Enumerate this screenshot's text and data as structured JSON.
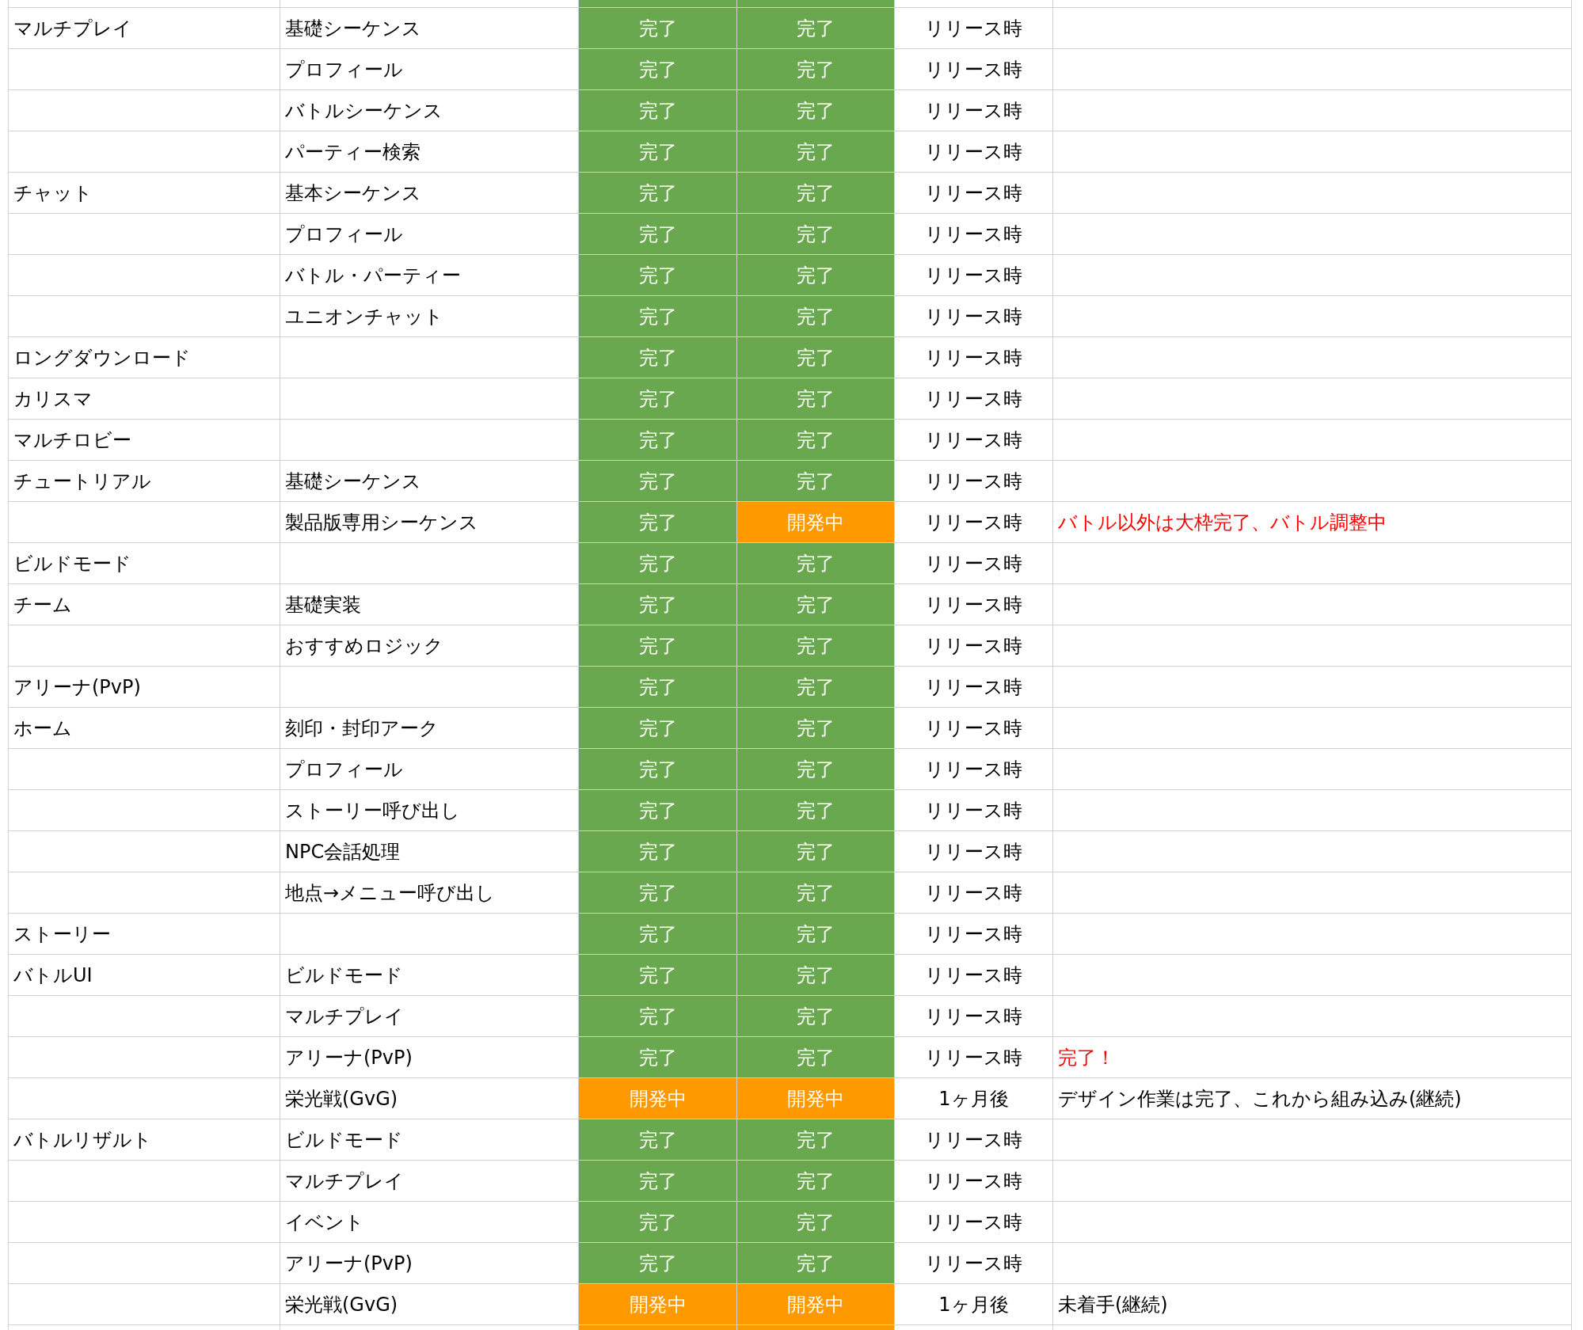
{
  "top_cut_row": {
    "status_cells": [
      {
        "color": "#6aa84f"
      },
      {
        "color": "#6aa84f"
      }
    ]
  },
  "rows": [
    {
      "category": "マルチプレイ",
      "item": "基礎シーケンス",
      "design": {
        "label": "完了",
        "color": "#6aa84f"
      },
      "impl": {
        "label": "完了",
        "color": "#6aa84f"
      },
      "timing": "リリース時"
    },
    {
      "item": "プロフィール",
      "design": {
        "label": "完了",
        "color": "#6aa84f"
      },
      "impl": {
        "label": "完了",
        "color": "#6aa84f"
      },
      "timing": "リリース時"
    },
    {
      "item": "バトルシーケンス",
      "design": {
        "label": "完了",
        "color": "#6aa84f"
      },
      "impl": {
        "label": "完了",
        "color": "#6aa84f"
      },
      "timing": "リリース時"
    },
    {
      "item": "パーティー検索",
      "design": {
        "label": "完了",
        "color": "#6aa84f"
      },
      "impl": {
        "label": "完了",
        "color": "#6aa84f"
      },
      "timing": "リリース時"
    },
    {
      "category": "チャット",
      "item": "基本シーケンス",
      "design": {
        "label": "完了",
        "color": "#6aa84f"
      },
      "impl": {
        "label": "完了",
        "color": "#6aa84f"
      },
      "timing": "リリース時"
    },
    {
      "item": "プロフィール",
      "design": {
        "label": "完了",
        "color": "#6aa84f"
      },
      "impl": {
        "label": "完了",
        "color": "#6aa84f"
      },
      "timing": "リリース時"
    },
    {
      "item": "バトル・パーティー",
      "design": {
        "label": "完了",
        "color": "#6aa84f"
      },
      "impl": {
        "label": "完了",
        "color": "#6aa84f"
      },
      "timing": "リリース時"
    },
    {
      "item": "ユニオンチャット",
      "design": {
        "label": "完了",
        "color": "#6aa84f"
      },
      "impl": {
        "label": "完了",
        "color": "#6aa84f"
      },
      "timing": "リリース時"
    },
    {
      "category": "ロングダウンロード",
      "design": {
        "label": "完了",
        "color": "#6aa84f"
      },
      "impl": {
        "label": "完了",
        "color": "#6aa84f"
      },
      "timing": "リリース時"
    },
    {
      "category": "カリスマ",
      "design": {
        "label": "完了",
        "color": "#6aa84f"
      },
      "impl": {
        "label": "完了",
        "color": "#6aa84f"
      },
      "timing": "リリース時"
    },
    {
      "category": "マルチロビー",
      "design": {
        "label": "完了",
        "color": "#6aa84f"
      },
      "impl": {
        "label": "完了",
        "color": "#6aa84f"
      },
      "timing": "リリース時"
    },
    {
      "category": "チュートリアル",
      "item": "基礎シーケンス",
      "design": {
        "label": "完了",
        "color": "#6aa84f"
      },
      "impl": {
        "label": "完了",
        "color": "#6aa84f"
      },
      "timing": "リリース時"
    },
    {
      "item": "製品版専用シーケンス",
      "design": {
        "label": "完了",
        "color": "#6aa84f"
      },
      "impl": {
        "label": "開発中",
        "color": "#ff9900"
      },
      "timing": "リリース時",
      "note": {
        "text": "バトル以外は大枠完了、バトル調整中",
        "color": "#ff0000"
      }
    },
    {
      "category": "ビルドモード",
      "design": {
        "label": "完了",
        "color": "#6aa84f"
      },
      "impl": {
        "label": "完了",
        "color": "#6aa84f"
      },
      "timing": "リリース時"
    },
    {
      "category": "チーム",
      "item": "基礎実装",
      "design": {
        "label": "完了",
        "color": "#6aa84f"
      },
      "impl": {
        "label": "完了",
        "color": "#6aa84f"
      },
      "timing": "リリース時"
    },
    {
      "item": "おすすめロジック",
      "design": {
        "label": "完了",
        "color": "#6aa84f"
      },
      "impl": {
        "label": "完了",
        "color": "#6aa84f"
      },
      "timing": "リリース時"
    },
    {
      "category": "アリーナ(PvP)",
      "design": {
        "label": "完了",
        "color": "#6aa84f"
      },
      "impl": {
        "label": "完了",
        "color": "#6aa84f"
      },
      "timing": "リリース時"
    },
    {
      "category": "ホーム",
      "item": "刻印・封印アーク",
      "design": {
        "label": "完了",
        "color": "#6aa84f"
      },
      "impl": {
        "label": "完了",
        "color": "#6aa84f"
      },
      "timing": "リリース時"
    },
    {
      "item": "プロフィール",
      "design": {
        "label": "完了",
        "color": "#6aa84f"
      },
      "impl": {
        "label": "完了",
        "color": "#6aa84f"
      },
      "timing": "リリース時"
    },
    {
      "item": "ストーリー呼び出し",
      "design": {
        "label": "完了",
        "color": "#6aa84f"
      },
      "impl": {
        "label": "完了",
        "color": "#6aa84f"
      },
      "timing": "リリース時"
    },
    {
      "item": "NPC会話処理",
      "design": {
        "label": "完了",
        "color": "#6aa84f"
      },
      "impl": {
        "label": "完了",
        "color": "#6aa84f"
      },
      "timing": "リリース時"
    },
    {
      "item": "地点→メニュー呼び出し",
      "design": {
        "label": "完了",
        "color": "#6aa84f"
      },
      "impl": {
        "label": "完了",
        "color": "#6aa84f"
      },
      "timing": "リリース時"
    },
    {
      "category": "ストーリー",
      "design": {
        "label": "完了",
        "color": "#6aa84f"
      },
      "impl": {
        "label": "完了",
        "color": "#6aa84f"
      },
      "timing": "リリース時"
    },
    {
      "category": "バトルUI",
      "item": "ビルドモード",
      "design": {
        "label": "完了",
        "color": "#6aa84f"
      },
      "impl": {
        "label": "完了",
        "color": "#6aa84f"
      },
      "timing": "リリース時"
    },
    {
      "item": "マルチプレイ",
      "design": {
        "label": "完了",
        "color": "#6aa84f"
      },
      "impl": {
        "label": "完了",
        "color": "#6aa84f"
      },
      "timing": "リリース時"
    },
    {
      "item": "アリーナ(PvP)",
      "design": {
        "label": "完了",
        "color": "#6aa84f"
      },
      "impl": {
        "label": "完了",
        "color": "#6aa84f"
      },
      "timing": "リリース時",
      "note": {
        "text": "完了！",
        "color": "#ff0000"
      }
    },
    {
      "item": "栄光戦(GvG)",
      "design": {
        "label": "開発中",
        "color": "#ff9900"
      },
      "impl": {
        "label": "開発中",
        "color": "#ff9900"
      },
      "timing": "1ヶ月後",
      "note": {
        "text": "デザイン作業は完了、これから組み込み(継続)",
        "color": "#000000"
      }
    },
    {
      "category": "バトルリザルト",
      "item": "ビルドモード",
      "design": {
        "label": "完了",
        "color": "#6aa84f"
      },
      "impl": {
        "label": "完了",
        "color": "#6aa84f"
      },
      "timing": "リリース時"
    },
    {
      "item": "マルチプレイ",
      "design": {
        "label": "完了",
        "color": "#6aa84f"
      },
      "impl": {
        "label": "完了",
        "color": "#6aa84f"
      },
      "timing": "リリース時"
    },
    {
      "item": "イベント",
      "design": {
        "label": "完了",
        "color": "#6aa84f"
      },
      "impl": {
        "label": "完了",
        "color": "#6aa84f"
      },
      "timing": "リリース時"
    },
    {
      "item": "アリーナ(PvP)",
      "design": {
        "label": "完了",
        "color": "#6aa84f"
      },
      "impl": {
        "label": "完了",
        "color": "#6aa84f"
      },
      "timing": "リリース時"
    },
    {
      "item": "栄光戦(GvG)",
      "design": {
        "label": "開発中",
        "color": "#ff9900"
      },
      "impl": {
        "label": "開発中",
        "color": "#ff9900"
      },
      "timing": "1ヶ月後",
      "note": {
        "text": "未着手(継続)",
        "color": "#000000"
      }
    }
  ],
  "bottom_cut_row": {
    "status_cells": [
      {
        "color": "#ff9900"
      },
      {
        "color": "#ff9900"
      }
    ]
  }
}
